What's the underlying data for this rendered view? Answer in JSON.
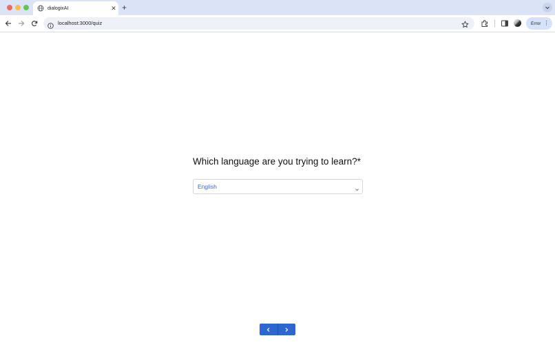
{
  "browser": {
    "tab": {
      "title": "dialogixAI",
      "close_glyph": "✕"
    },
    "new_tab_glyph": "+",
    "address": {
      "url": "localhost:3000/quiz"
    },
    "error_chip": {
      "label": "Error"
    }
  },
  "quiz": {
    "question": "Which language are you trying to learn?*",
    "language_select": {
      "value": "English"
    }
  },
  "colors": {
    "accent": "#2e66d1",
    "select_text": "#3a66c8",
    "chrome_frame": "#dbe3f6"
  },
  "icons": [
    "globe-icon",
    "close-icon",
    "plus-icon",
    "chevron-down-icon",
    "back-arrow-icon",
    "forward-arrow-icon",
    "reload-icon",
    "info-icon",
    "star-icon",
    "extensions-icon",
    "side-panel-icon",
    "more-vert-icon",
    "chevron-left-icon",
    "chevron-right-icon"
  ]
}
